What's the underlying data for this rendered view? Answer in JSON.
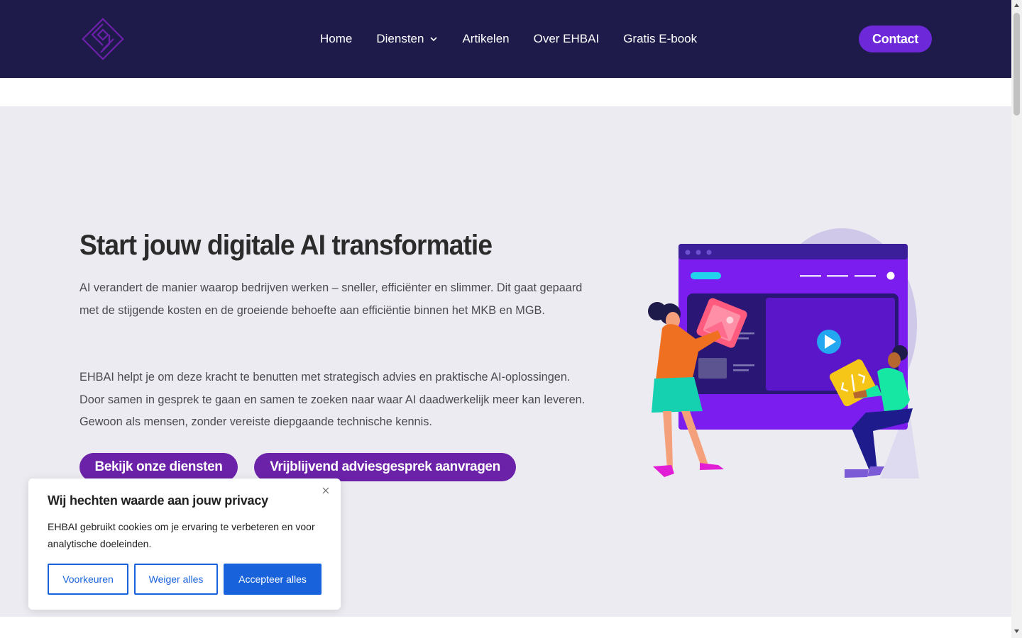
{
  "header": {
    "nav": [
      {
        "label": "Home"
      },
      {
        "label": "Diensten",
        "icon": "chevron-down-icon"
      },
      {
        "label": "Artikelen"
      },
      {
        "label": "Over EHBAI"
      },
      {
        "label": "Gratis E-book"
      }
    ],
    "contact_label": "Contact"
  },
  "hero": {
    "title": "Start jouw digitale AI transformatie",
    "paragraph1": "AI verandert de manier waarop bedrijven werken – sneller, efficiënter en slimmer. Dit gaat gepaard met de stijgende kosten en de groeiende behoefte aan efficiëntie binnen het MKB en MGB.",
    "paragraph2": "EHBAI helpt je om deze kracht te benutten met strategisch advies en praktische AI-oplossingen. Door samen in gesprek te gaan en samen te zoeken naar waar AI daadwerkelijk meer kan leveren. Gewoon als mensen, zonder vereiste diepgaande technische kennis.",
    "btn_services": "Bekijk onze diensten",
    "btn_advice": "Vrijblijvend adviesgesprek aanvragen"
  },
  "cookie": {
    "title": "Wij hechten waarde aan jouw privacy",
    "text": "EHBAI gebruikt cookies om je ervaring te verbeteren en voor analytische doeleinden.",
    "btn_preferences": "Voorkeuren",
    "btn_reject": "Weiger alles",
    "btn_accept": "Accepteer alles"
  },
  "colors": {
    "header_bg": "#1e1b4b",
    "brand_purple": "#6b21a8",
    "hero_bg": "#ecebf1",
    "cookie_blue": "#1863dc"
  }
}
